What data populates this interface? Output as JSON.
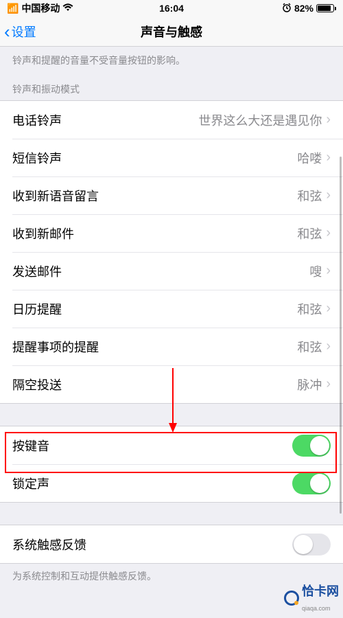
{
  "statusbar": {
    "signal": "▪▎▎▎",
    "carrier": "中国移动",
    "wifi": "✦",
    "time": "16:04",
    "alarm": "⏰",
    "battery_pct": "82%"
  },
  "navbar": {
    "back_label": "设置",
    "title": "声音与触感"
  },
  "top_note": "铃声和提醒的音量不受音量按钮的影响。",
  "section_header": "铃声和振动模式",
  "rows": [
    {
      "label": "电话铃声",
      "value": "世界这么大还是遇见你"
    },
    {
      "label": "短信铃声",
      "value": "哈喽"
    },
    {
      "label": "收到新语音留言",
      "value": "和弦"
    },
    {
      "label": "收到新邮件",
      "value": "和弦"
    },
    {
      "label": "发送邮件",
      "value": "嗖"
    },
    {
      "label": "日历提醒",
      "value": "和弦"
    },
    {
      "label": "提醒事项的提醒",
      "value": "和弦"
    },
    {
      "label": "隔空投送",
      "value": "脉冲"
    }
  ],
  "switches": {
    "keyboard_clicks": {
      "label": "按键音",
      "on": true
    },
    "lock_sound": {
      "label": "锁定声",
      "on": true
    }
  },
  "haptics": {
    "label": "系统触感反馈",
    "on": false,
    "note": "为系统控制和互动提供触感反馈。"
  },
  "watermark": "恰卡网",
  "watermark_sub": "qiaqa.com"
}
